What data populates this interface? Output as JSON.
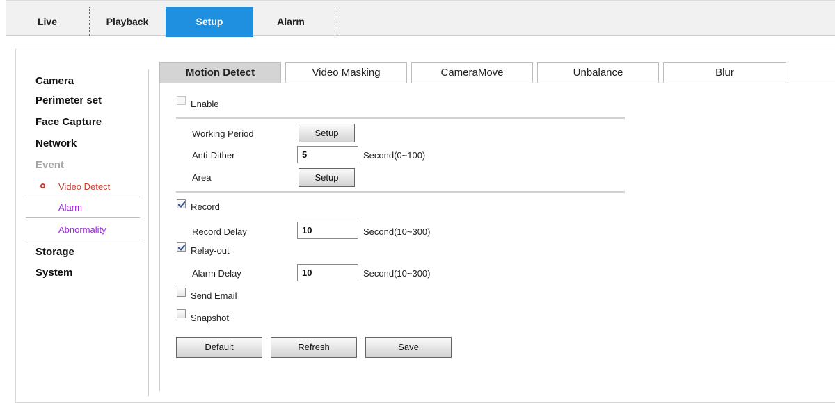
{
  "topnav": {
    "tabs": [
      {
        "label": "Live"
      },
      {
        "label": "Playback"
      },
      {
        "label": "Setup"
      },
      {
        "label": "Alarm"
      }
    ],
    "active": "Setup"
  },
  "sidebar": {
    "camera": "Camera",
    "perimeter": "Perimeter set",
    "face_capture": "Face Capture",
    "network": "Network",
    "event": "Event",
    "video_detect": "Video Detect",
    "alarm": "Alarm",
    "abnormality": "Abnormality",
    "storage": "Storage",
    "system": "System"
  },
  "tabs": {
    "motion_detect": "Motion Detect",
    "video_masking": "Video Masking",
    "camera_move": "CameraMove",
    "unbalance": "Unbalance",
    "blur": "Blur",
    "active": "Motion Detect"
  },
  "form": {
    "enable": {
      "label": "Enable",
      "checked": false,
      "disabled": true
    },
    "working_period": {
      "label": "Working Period",
      "button": "Setup"
    },
    "anti_dither": {
      "label": "Anti-Dither",
      "value": "5",
      "unit": "Second(0~100)"
    },
    "area": {
      "label": "Area",
      "button": "Setup"
    },
    "record": {
      "label": "Record",
      "checked": true
    },
    "record_delay": {
      "label": "Record Delay",
      "value": "10",
      "unit": "Second(10~300)"
    },
    "relay_out": {
      "label": "Relay-out",
      "checked": true
    },
    "alarm_delay": {
      "label": "Alarm Delay",
      "value": "10",
      "unit": "Second(10~300)"
    },
    "send_email": {
      "label": "Send Email",
      "checked": false
    },
    "snapshot": {
      "label": "Snapshot",
      "checked": false
    }
  },
  "actions": {
    "default": "Default",
    "refresh": "Refresh",
    "save": "Save"
  },
  "colors": {
    "active_nav": "#1f8fe0",
    "active_subitem": "#d23a2e",
    "subitem": "#9a2bd6",
    "active_tab_bg": "#d4d4d4"
  }
}
